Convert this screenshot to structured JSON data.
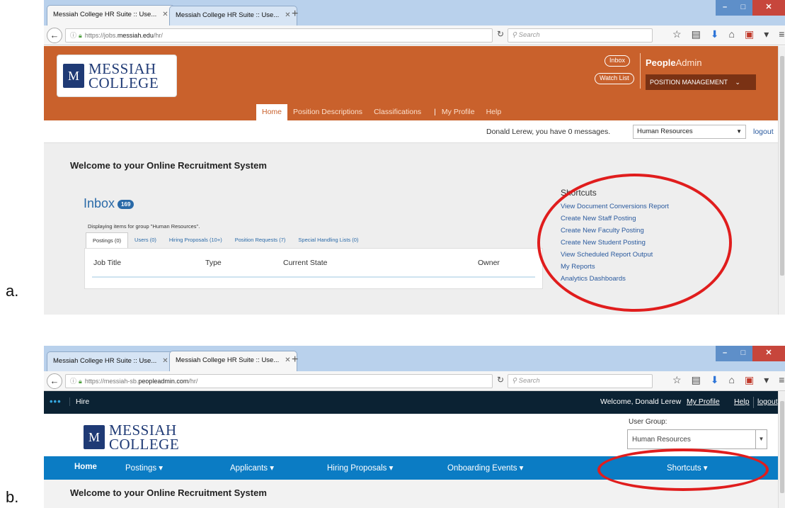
{
  "labels": {
    "a": "a.",
    "b": "b."
  },
  "browser": {
    "tab_title": "Messiah College HR Suite :: Use...",
    "search_placeholder": "Search",
    "colors": {
      "tabbar": "#b9d1ec",
      "close": "#c7463c"
    }
  },
  "screenshot_a": {
    "url_prefix": "https://jobs.",
    "url_domain": "messiah.edu",
    "url_suffix": "/hr/",
    "logo": {
      "line1": "MESSIAH",
      "line2": "COLLEGE",
      "seal": "M"
    },
    "inbox_pill": "Inbox",
    "watchlist_pill": "Watch List",
    "brand_bold": "People",
    "brand_light": "Admin",
    "position_management": "POSITION MANAGEMENT",
    "nav": {
      "home": "Home",
      "position_descriptions": "Position Descriptions",
      "classifications": "Classifications",
      "my_profile": "My Profile",
      "help": "Help"
    },
    "messages": "Donald Lerew, you have 0 messages.",
    "group_select": "Human Resources",
    "logout": "logout",
    "welcome": "Welcome to your Online Recruitment System",
    "inbox_title": "Inbox",
    "inbox_count": "169",
    "displaying": "Displaying items for group \"Human Resources\".",
    "tabs": [
      "Postings (0)",
      "Users (0)",
      "Hiring Proposals (10+)",
      "Position Requests (7)",
      "Special Handling Lists (0)"
    ],
    "columns": [
      "Job Title",
      "Type",
      "Current State",
      "Owner"
    ],
    "shortcuts_heading": "Shortcuts",
    "shortcuts": [
      "View Document Conversions Report",
      "Create New Staff Posting",
      "Create New Faculty Posting",
      "Create New Student Posting",
      "View Scheduled Report Output",
      "My Reports",
      "Analytics Dashboards"
    ],
    "colors": {
      "header": "#c9612c",
      "link": "#2a5a9e",
      "highlight": "#e01d1d"
    }
  },
  "screenshot_b": {
    "url_prefix": "https://messiah-sb.",
    "url_domain": "peopleadmin.com",
    "url_suffix": "/hr/",
    "hire": "Hire",
    "welcome_user": "Welcome, Donald Lerew",
    "my_profile": "My Profile",
    "help": "Help",
    "logout": "logout",
    "logo": {
      "line1": "MESSIAH",
      "line2": "COLLEGE",
      "seal": "M"
    },
    "user_group_label": "User Group:",
    "user_group_value": "Human Resources",
    "nav": {
      "home": "Home",
      "postings": "Postings ▾",
      "applicants": "Applicants ▾",
      "hiring_proposals": "Hiring Proposals ▾",
      "onboarding_events": "Onboarding Events ▾",
      "shortcuts": "Shortcuts ▾"
    },
    "welcome": "Welcome to your Online Recruitment System",
    "colors": {
      "topbar": "#0b2233",
      "nav": "#0b7cc4",
      "highlight": "#e01d1d"
    }
  }
}
